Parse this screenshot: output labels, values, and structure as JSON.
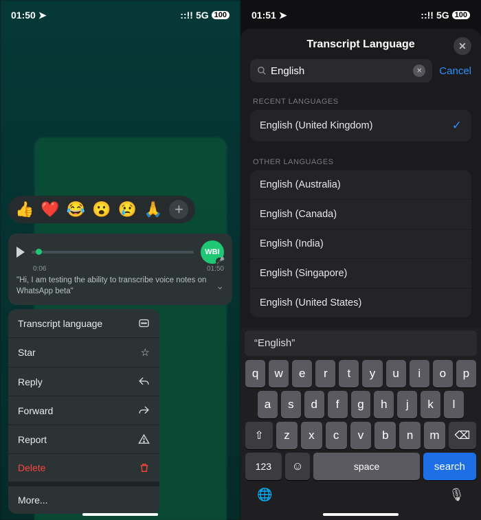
{
  "left": {
    "status": {
      "time": "01:50",
      "network": "5G",
      "battery": "100"
    },
    "reactions": [
      "👍",
      "❤️",
      "😂",
      "😮",
      "😢",
      "🙏"
    ],
    "voice": {
      "start_time": "0:06",
      "end_time": "01:50",
      "avatar_label": "WBI",
      "transcript": "\"Hi, I am testing the ability to transcribe voice notes on WhatsApp beta\""
    },
    "menu": {
      "transcript_language": "Transcript language",
      "star": "Star",
      "reply": "Reply",
      "forward": "Forward",
      "report": "Report",
      "delete": "Delete",
      "more": "More..."
    }
  },
  "right": {
    "status": {
      "time": "01:51",
      "network": "5G",
      "battery": "100"
    },
    "sheet": {
      "title": "Transcript Language",
      "search_value": "English",
      "cancel": "Cancel",
      "recent_header": "RECENT LANGUAGES",
      "other_header": "OTHER LANGUAGES",
      "recent": [
        "English (United Kingdom)"
      ],
      "other": [
        "English (Australia)",
        "English (Canada)",
        "English (India)",
        "English (Singapore)",
        "English (United States)"
      ]
    },
    "keyboard": {
      "suggestion": "“English”",
      "row1": [
        "q",
        "w",
        "e",
        "r",
        "t",
        "y",
        "u",
        "i",
        "o",
        "p"
      ],
      "row2": [
        "a",
        "s",
        "d",
        "f",
        "g",
        "h",
        "j",
        "k",
        "l"
      ],
      "row3": [
        "z",
        "x",
        "c",
        "v",
        "b",
        "n",
        "m"
      ],
      "numkey": "123",
      "space": "space",
      "search": "search"
    }
  }
}
